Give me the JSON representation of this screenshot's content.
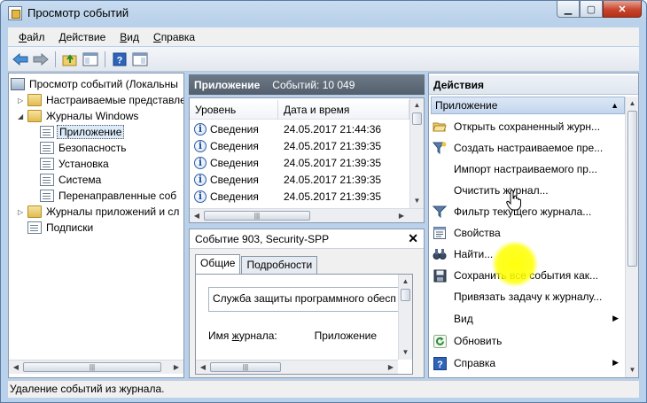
{
  "window": {
    "title": "Просмотр событий"
  },
  "menu": [
    {
      "pre": "",
      "u": "Ф",
      "post": "айл"
    },
    {
      "pre": "",
      "u": "Д",
      "post": "ействие"
    },
    {
      "pre": "",
      "u": "В",
      "post": "ид"
    },
    {
      "pre": "",
      "u": "С",
      "post": "правка"
    }
  ],
  "tree": {
    "items": [
      {
        "label": "Просмотр событий (Локальны"
      },
      {
        "label": "Настраиваемые представле"
      },
      {
        "label": "Журналы Windows"
      },
      {
        "label": "Приложение"
      },
      {
        "label": "Безопасность"
      },
      {
        "label": "Установка"
      },
      {
        "label": "Система"
      },
      {
        "label": "Перенаправленные соб"
      },
      {
        "label": "Журналы приложений и сл"
      },
      {
        "label": "Подписки"
      }
    ]
  },
  "log": {
    "name": "Приложение",
    "count": "Событий: 10 049",
    "columns": [
      "Уровень",
      "Дата и время"
    ],
    "rows": [
      {
        "level": "Сведения",
        "date": "24.05.2017 21:44:36"
      },
      {
        "level": "Сведения",
        "date": "24.05.2017 21:39:35"
      },
      {
        "level": "Сведения",
        "date": "24.05.2017 21:39:35"
      },
      {
        "level": "Сведения",
        "date": "24.05.2017 21:39:35"
      },
      {
        "level": "Сведения",
        "date": "24.05.2017 21:39:35"
      }
    ]
  },
  "detail": {
    "title": "Событие 903, Security-SPP",
    "tabs": [
      "Общие",
      "Подробности"
    ],
    "description": "Служба защиты программного обесп",
    "log_label_pre": "Имя ",
    "log_label_u": "ж",
    "log_label_post": "урнала:",
    "log_value": "Приложение"
  },
  "actions": {
    "title": "Действия",
    "section": "Приложение",
    "items": [
      {
        "label": "Открыть сохраненный журн..."
      },
      {
        "label": "Создать настраиваемое пре..."
      },
      {
        "label": "Импорт настраиваемого пр..."
      },
      {
        "label": "Очистить журнал..."
      },
      {
        "label": "Фильтр текущего журнала..."
      },
      {
        "label": "Свойства"
      },
      {
        "label": "Найти..."
      },
      {
        "label": "Сохранить все события как..."
      },
      {
        "label": "Привязать задачу к журналу..."
      },
      {
        "label": "Вид"
      },
      {
        "label": "Обновить"
      },
      {
        "label": "Справка"
      }
    ]
  },
  "status": {
    "text": "Удаление событий из журнала."
  },
  "colors": {
    "accent": "#3a6db5",
    "chrome": "#b9d1ea",
    "highlight": "#ffff00"
  }
}
